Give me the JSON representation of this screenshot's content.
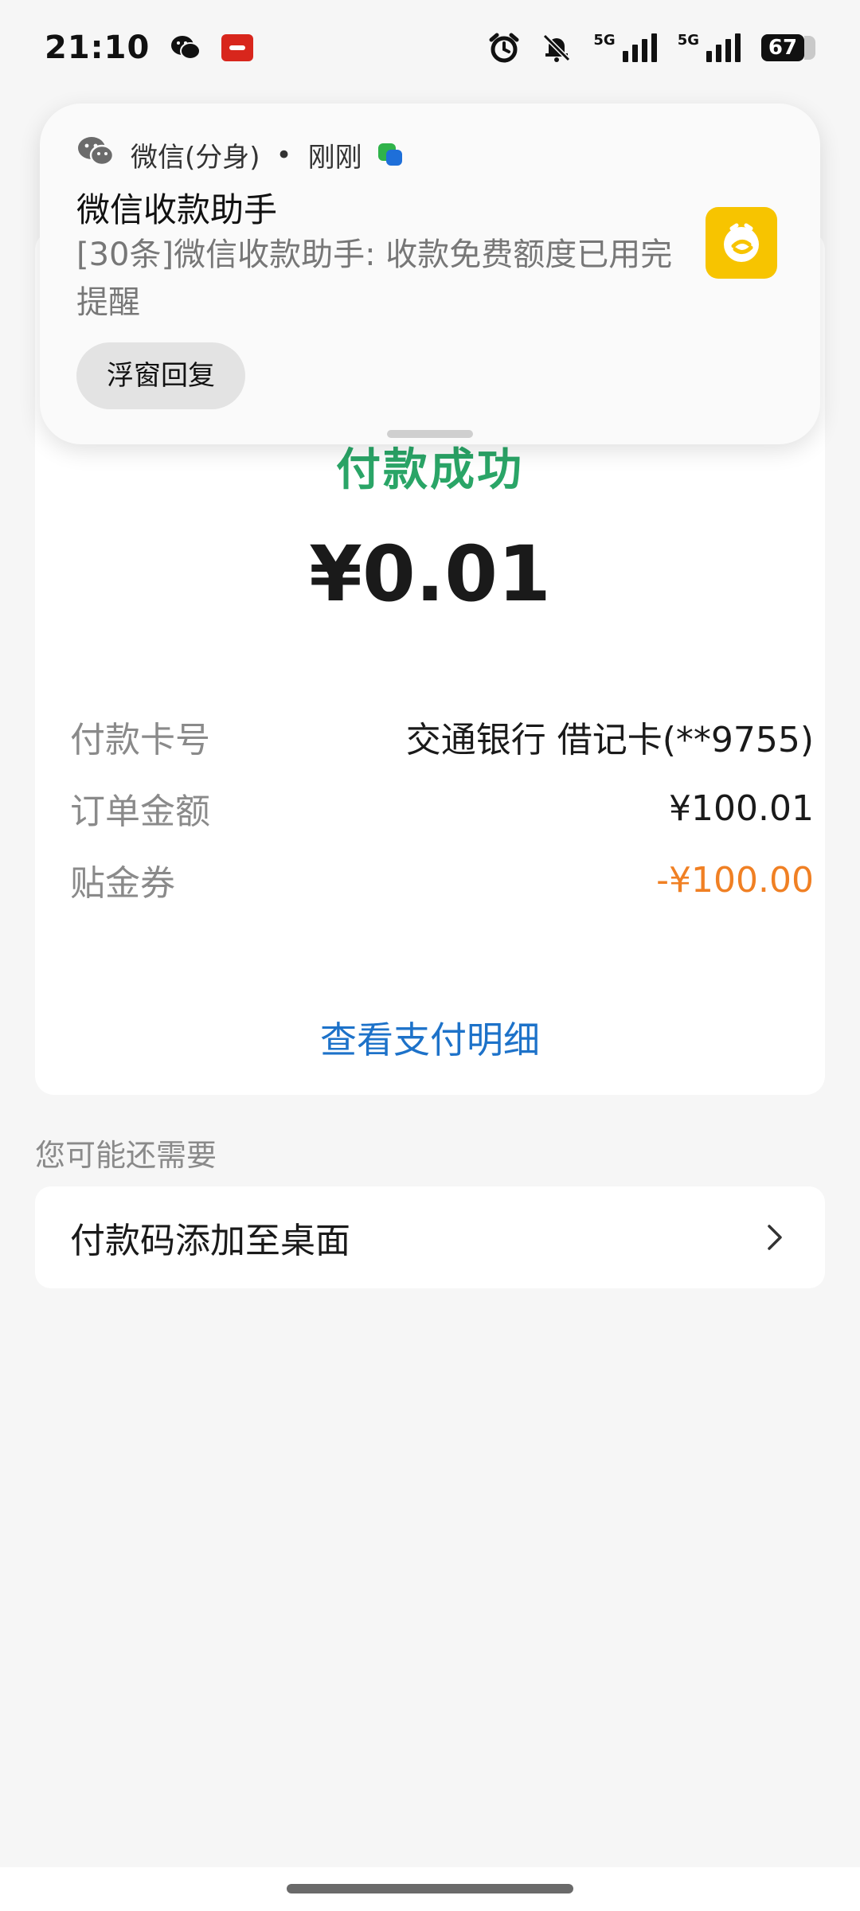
{
  "status_bar": {
    "time": "21:10",
    "battery": "67",
    "network_1": "5G",
    "network_2": "5G",
    "icons": [
      "wechat-icon",
      "payment-app-icon",
      "alarm-icon",
      "bell-off-icon",
      "signal-icon",
      "signal-icon",
      "battery-icon"
    ]
  },
  "notification": {
    "app_name": "微信(分身)",
    "separator": "•",
    "time": "刚刚",
    "title": "微信收款助手",
    "body": "[30条]微信收款助手: 收款免费额度已用完提醒",
    "reply_button": "浮窗回复",
    "app_icon_color": "#f7c400"
  },
  "result": {
    "status": "付款成功",
    "amount": "¥0.01",
    "rows": [
      {
        "label": "付款卡号",
        "value": "交通银行 借记卡(**9755)"
      },
      {
        "label": "订单金额",
        "value": "¥100.01"
      },
      {
        "label": "贴金券",
        "value": "-¥100.00"
      }
    ],
    "detail_link": "查看支付明细"
  },
  "suggestions": {
    "section_label": "您可能还需要",
    "item": "付款码添加至桌面"
  },
  "colors": {
    "success_green": "#2aa567",
    "link_blue": "#1d72c9",
    "discount_orange": "#f08024"
  }
}
